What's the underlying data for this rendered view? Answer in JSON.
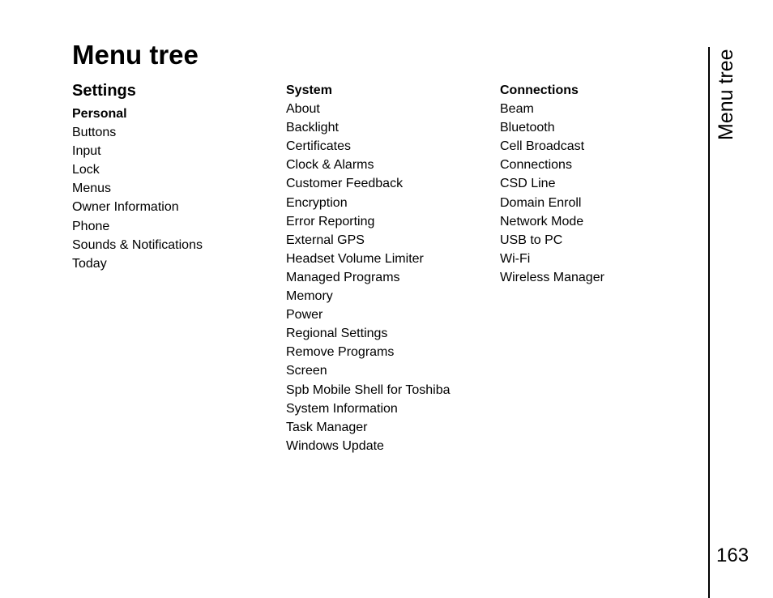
{
  "page": {
    "title": "Menu tree",
    "side_label": "Menu tree",
    "page_number": "163"
  },
  "settings": {
    "heading": "Settings",
    "personal": {
      "title": "Personal",
      "items": [
        "Buttons",
        "Input",
        "Lock",
        "Menus",
        "Owner Information",
        "Phone",
        "Sounds & Notifications",
        "Today"
      ]
    },
    "system": {
      "title": "System",
      "items": [
        "About",
        "Backlight",
        "Certificates",
        "Clock & Alarms",
        "Customer Feedback",
        "Encryption",
        "Error Reporting",
        "External GPS",
        "Headset Volume Limiter",
        "Managed Programs",
        "Memory",
        "Power",
        "Regional Settings",
        "Remove Programs",
        "Screen",
        "Spb Mobile Shell for Toshiba",
        "System Information",
        "Task Manager",
        "Windows Update"
      ]
    },
    "connections": {
      "title": "Connections",
      "items": [
        "Beam",
        "Bluetooth",
        "Cell Broadcast",
        "Connections",
        "CSD Line",
        "Domain Enroll",
        "Network Mode",
        "USB to PC",
        "Wi-Fi",
        "Wireless Manager"
      ]
    }
  }
}
